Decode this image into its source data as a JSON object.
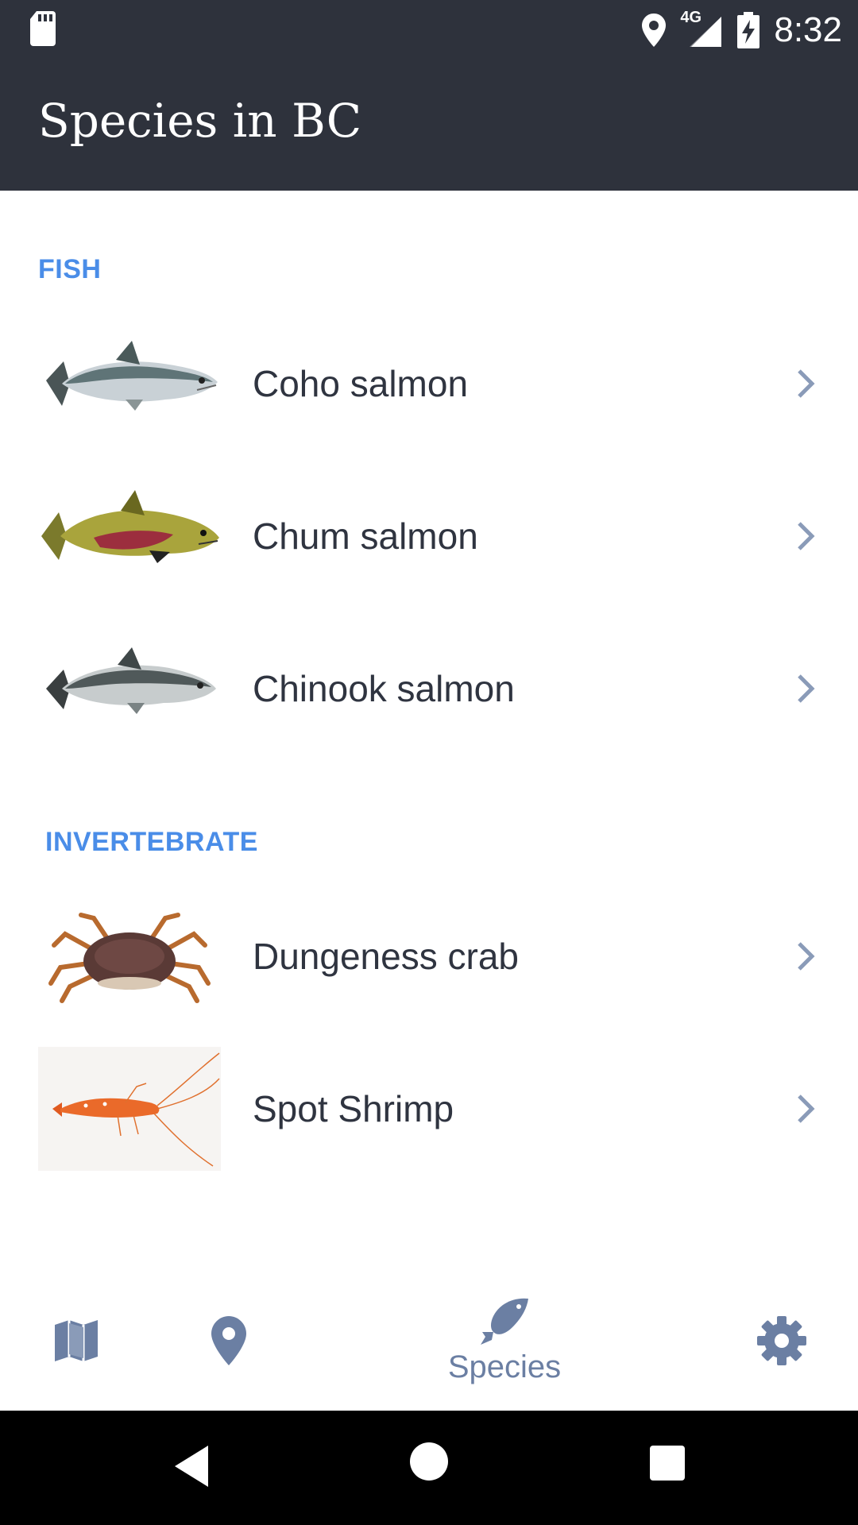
{
  "status_bar": {
    "time": "8:32",
    "network": "4G",
    "icons": [
      "sd-card-icon",
      "location-icon",
      "signal-icon",
      "battery-charging-icon"
    ]
  },
  "app_bar": {
    "title": "Species in BC"
  },
  "sections": [
    {
      "header": "FISH",
      "items": [
        {
          "label": "Coho salmon",
          "icon": "coho-salmon-image"
        },
        {
          "label": "Chum salmon",
          "icon": "chum-salmon-image"
        },
        {
          "label": "Chinook salmon",
          "icon": "chinook-salmon-image"
        }
      ]
    },
    {
      "header": "INVERTEBRATE",
      "items": [
        {
          "label": "Dungeness crab",
          "icon": "dungeness-crab-image"
        },
        {
          "label": "Spot Shrimp",
          "icon": "spot-shrimp-image"
        }
      ]
    }
  ],
  "bottom_nav": {
    "items": [
      {
        "icon": "map-icon",
        "label": ""
      },
      {
        "icon": "location-pin-icon",
        "label": ""
      },
      {
        "icon": "fish-icon",
        "label": "Species",
        "active": true
      },
      {
        "icon": "gear-icon",
        "label": ""
      }
    ]
  },
  "colors": {
    "app_bar": "#2e323c",
    "section_header": "#4a8de8",
    "nav_icon": "#6b7fa3",
    "chevron": "#8a9bb8",
    "text": "#2f3440"
  },
  "system_nav": {
    "icons": [
      "back-icon",
      "home-icon",
      "recents-icon"
    ]
  }
}
